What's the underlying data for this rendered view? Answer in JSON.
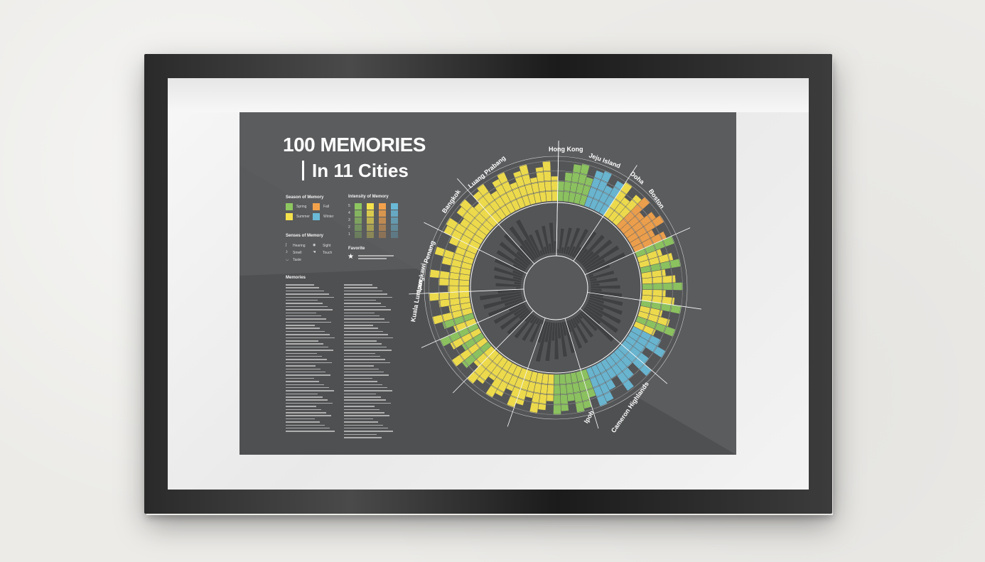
{
  "poster": {
    "title_line1": "100 MEMORIES",
    "title_line2": "In 11 Cities"
  },
  "legend": {
    "season_heading": "Season of Memory",
    "seasons": [
      {
        "label": "Spring",
        "color": "#8ec760"
      },
      {
        "label": "Fall",
        "color": "#f3a24b"
      },
      {
        "label": "Summer",
        "color": "#f4e24c"
      },
      {
        "label": "Winter",
        "color": "#6ab9d6"
      }
    ],
    "intensity_heading": "Intensity of Memory",
    "intensity_levels": [
      "5",
      "4",
      "3",
      "2",
      "1"
    ],
    "senses_heading": "Senses of Memory",
    "senses": [
      {
        "label": "Hearing",
        "icon": "ear-icon"
      },
      {
        "label": "Sight",
        "icon": "eye-icon"
      },
      {
        "label": "Smell",
        "icon": "nose-icon"
      },
      {
        "label": "Touch",
        "icon": "hand-icon"
      },
      {
        "label": "Taste",
        "icon": "mouth-icon"
      }
    ],
    "favorite_heading": "Favorite",
    "favorite_icon": "star-icon",
    "memories_heading": "Memories"
  },
  "cities": [
    "Hong Kong",
    "Jeju Island",
    "Doha",
    "Boston",
    "Cameron Highlands",
    "Ipoh",
    "Kuala Lumpur",
    "Langkawi",
    "Penang",
    "Bangkok",
    "Luang Prabang"
  ]
}
